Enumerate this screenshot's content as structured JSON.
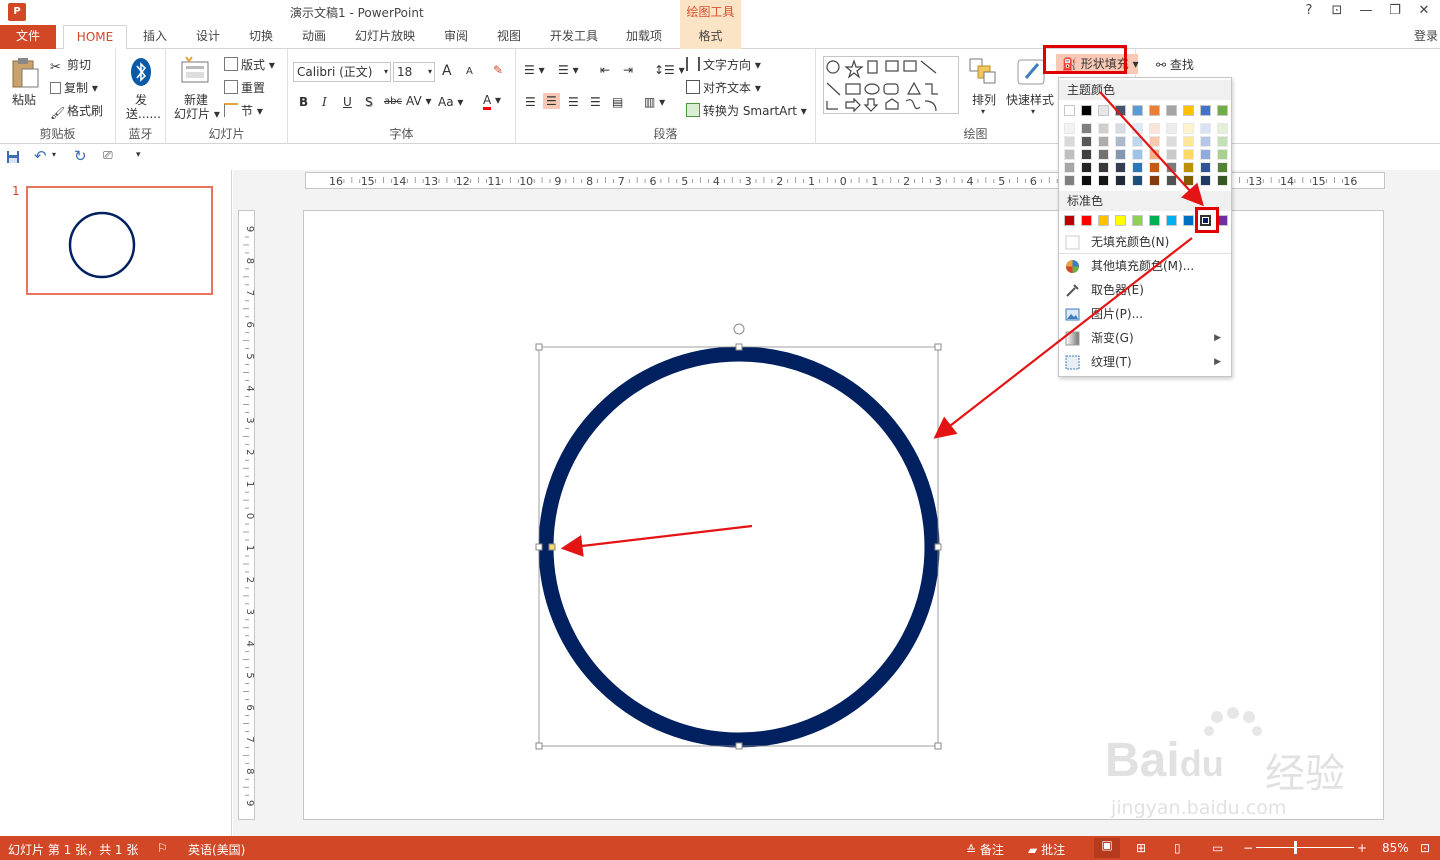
{
  "window": {
    "title": "演示文稿1 - PowerPoint",
    "logo_text": "P",
    "context_tools": "绘图工具",
    "buttons": [
      "?",
      "⊡",
      "—",
      "❐",
      "✕"
    ],
    "login": "登录"
  },
  "tabs": [
    "文件",
    "HOME",
    "插入",
    "设计",
    "切换",
    "动画",
    "幻灯片放映",
    "审阅",
    "视图",
    "开发工具",
    "加载项",
    "格式"
  ],
  "ribbon": {
    "clipboard": {
      "label": "剪贴板",
      "paste": "粘贴",
      "cut": "剪切",
      "copy": "复制",
      "format_painter": "格式刷"
    },
    "bluetooth": {
      "label": "蓝牙",
      "send": "发送......",
      "send_line1": "发",
      "send_line2": "送......"
    },
    "slides": {
      "label": "幻灯片",
      "new_slide_line1": "新建",
      "new_slide_line2": "幻灯片",
      "layout": "版式",
      "reset": "重置",
      "section": "节"
    },
    "font": {
      "label": "字体",
      "font_name": "Calibri (正文)",
      "font_size": "18",
      "bold": "B",
      "italic": "I",
      "underline": "U",
      "shadow": "S",
      "strike": "abc",
      "spacing": "AV",
      "case": "Aa",
      "grow": "A",
      "shrink": "A",
      "color": "A"
    },
    "paragraph": {
      "label": "段落",
      "text_direction": "文字方向",
      "align_text": "对齐文本",
      "smartart": "转换为 SmartArt"
    },
    "drawing": {
      "label": "绘图",
      "arrange": "排列",
      "quick_styles": "快速样式",
      "shape_fill": "形状填充",
      "find": "查找"
    }
  },
  "ruler": {
    "h_ticks": [
      "16",
      "15",
      "14",
      "13",
      "12",
      "11",
      "10",
      "9",
      "8",
      "7",
      "6",
      "5",
      "4",
      "3",
      "2",
      "1",
      "0",
      "1",
      "2",
      "3",
      "4",
      "5",
      "6",
      "7",
      "8",
      "9",
      "10",
      "11",
      "12",
      "13",
      "14",
      "15",
      "16"
    ],
    "v_ticks": [
      "9",
      "8",
      "7",
      "6",
      "5",
      "4",
      "3",
      "2",
      "1",
      "0",
      "1",
      "2",
      "3",
      "4",
      "5",
      "6",
      "7",
      "8",
      "9"
    ]
  },
  "thumbnails": {
    "slide_number": "1"
  },
  "fill_menu": {
    "theme_header": "主题颜色",
    "standard_header": "标准色",
    "theme_top": [
      "#ffffff",
      "#000000",
      "#e7e6e6",
      "#44546a",
      "#5b9bd5",
      "#ed7d31",
      "#a5a5a5",
      "#ffc000",
      "#4472c4",
      "#70ad47"
    ],
    "theme_columns": [
      [
        "#f2f2f2",
        "#d9d9d9",
        "#bfbfbf",
        "#a6a6a6",
        "#808080"
      ],
      [
        "#7f7f7f",
        "#595959",
        "#404040",
        "#262626",
        "#0d0d0d"
      ],
      [
        "#d0cece",
        "#aeabab",
        "#757171",
        "#3a3838",
        "#171616"
      ],
      [
        "#d6dce4",
        "#adb9ca",
        "#8497b0",
        "#333f50",
        "#222a35"
      ],
      [
        "#ddebf7",
        "#bdd7ee",
        "#9dc3e6",
        "#2e75b6",
        "#1f4e79"
      ],
      [
        "#fbe5d6",
        "#f8cbad",
        "#f4b183",
        "#c55a11",
        "#843c0c"
      ],
      [
        "#ededed",
        "#dbdbdb",
        "#c9c9c9",
        "#7b7b7b",
        "#525252"
      ],
      [
        "#fff2cc",
        "#ffe699",
        "#ffd966",
        "#bf9000",
        "#7f6000"
      ],
      [
        "#dae3f3",
        "#b4c7e7",
        "#8faadc",
        "#2f5597",
        "#1f3864"
      ],
      [
        "#e2f0d9",
        "#c5e0b4",
        "#a9d18e",
        "#548235",
        "#385723"
      ]
    ],
    "standard": [
      "#c00000",
      "#ff0000",
      "#ffc000",
      "#ffff00",
      "#92d050",
      "#00b050",
      "#00b0f0",
      "#0070c0",
      "#002060",
      "#7030a0"
    ],
    "items": [
      {
        "label": "无填充颜色(N)",
        "icon": "no-fill-icon"
      },
      {
        "label": "其他填充颜色(M)...",
        "icon": "color-wheel-icon"
      },
      {
        "label": "取色器(E)",
        "icon": "eyedropper-icon"
      },
      {
        "label": "图片(P)...",
        "icon": "picture-icon"
      },
      {
        "label": "渐变(G)",
        "icon": "gradient-icon",
        "submenu": true
      },
      {
        "label": "纹理(T)",
        "icon": "texture-icon",
        "submenu": true
      }
    ]
  },
  "colors": {
    "accent": "#d24726",
    "circle_stroke": "#002060",
    "highlight_box": "#e00000",
    "arrow": "#e51414",
    "selected_swatch": "#002060"
  },
  "status": {
    "slide_info": "幻灯片 第 1 张，共 1 张",
    "language": "英语(美国)",
    "notes": "备注",
    "comments": "批注",
    "zoom": "85%"
  },
  "watermark": {
    "brand": "Bai",
    "brand2": "du",
    "service": "经验",
    "url": "jingyan.baidu.com"
  }
}
